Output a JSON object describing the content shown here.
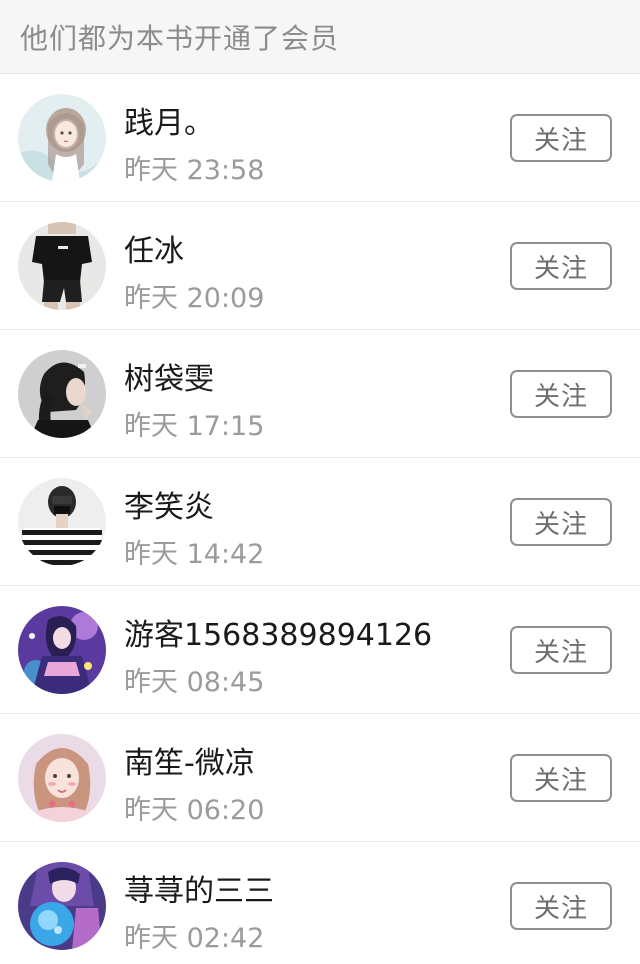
{
  "header": {
    "title": "他们都为本书开通了会员"
  },
  "follow_label": "关注",
  "members": [
    {
      "name": "践月。",
      "time": "昨天 23:58",
      "avatar": "anime-girl-sketch"
    },
    {
      "name": "任冰",
      "time": "昨天 20:09",
      "avatar": "person-black-outfit"
    },
    {
      "name": "树袋雯",
      "time": "昨天 17:15",
      "avatar": "girl-dark-hair"
    },
    {
      "name": "李笑炎",
      "time": "昨天 14:42",
      "avatar": "person-striped-shirt"
    },
    {
      "name": "游客1568389894126",
      "time": "昨天 08:45",
      "avatar": "anime-purple-character"
    },
    {
      "name": "南笙-微凉",
      "time": "昨天 06:20",
      "avatar": "girl-pink-hearts"
    },
    {
      "name": "荨荨的三三",
      "time": "昨天 02:42",
      "avatar": "anime-blue-orb"
    }
  ]
}
